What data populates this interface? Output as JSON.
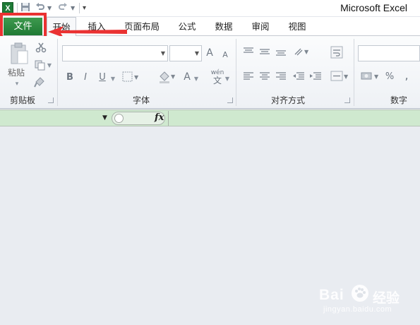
{
  "window": {
    "title": "Microsoft Excel"
  },
  "quick_access": {
    "excel_logo": "X",
    "save_icon": "save-icon",
    "undo_icon": "undo-icon",
    "redo_icon": "redo-icon",
    "customize_icon": "customize-icon"
  },
  "tabs": [
    {
      "label": "文件",
      "active": false,
      "highlighted": true
    },
    {
      "label": "开始",
      "active": true
    },
    {
      "label": "插入"
    },
    {
      "label": "页面布局"
    },
    {
      "label": "公式"
    },
    {
      "label": "数据"
    },
    {
      "label": "审阅"
    },
    {
      "label": "视图"
    }
  ],
  "ribbon": {
    "clipboard": {
      "label": "剪贴板",
      "paste_label": "粘贴"
    },
    "font": {
      "label": "字体",
      "font_name": "",
      "font_size": "",
      "grow": "A",
      "shrink": "A",
      "bold": "B",
      "italic": "I",
      "underline": "U",
      "wen": "wén",
      "wen_base": "文"
    },
    "alignment": {
      "label": "对齐方式"
    },
    "number": {
      "label": "数字",
      "percent": "%",
      "comma": ","
    }
  },
  "formula_bar": {
    "fx_label": "fx",
    "name_box": "",
    "formula": ""
  },
  "watermark": {
    "brand_a": "Bai",
    "brand_b": "du",
    "brand_cn": "经验",
    "url": "jingyan.baidu.com"
  },
  "colors": {
    "file_tab": "#1f7a34",
    "highlight": "#ea3232",
    "formula_bar": "#cfe9cf",
    "sheet_bg": "#e9ecf1"
  }
}
